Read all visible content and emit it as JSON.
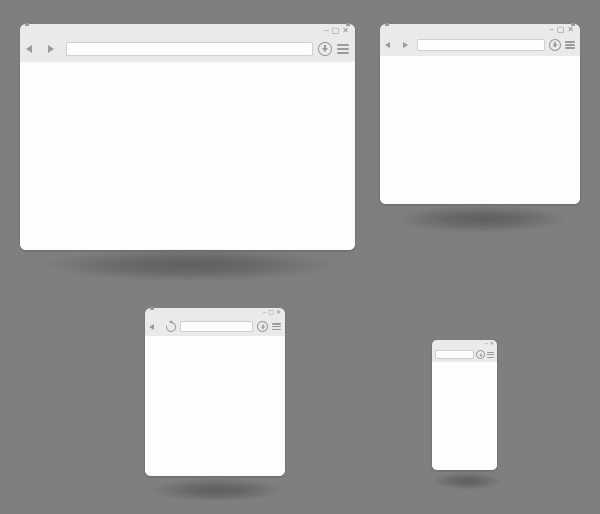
{
  "windows": [
    {
      "type": "desktop-large",
      "controls": {
        "minimize": "–",
        "maximize": "▢",
        "close": "✕"
      },
      "navigation": {
        "back": "back",
        "forward": "forward"
      },
      "url_value": "",
      "download_icon": "download",
      "menu_icon": "menu"
    },
    {
      "type": "desktop-medium",
      "controls": {
        "minimize": "–",
        "maximize": "▢",
        "close": "✕"
      },
      "navigation": {
        "back": "back",
        "forward": "forward"
      },
      "url_value": "",
      "download_icon": "download",
      "menu_icon": "menu"
    },
    {
      "type": "tablet",
      "controls": {
        "minimize": "–",
        "maximize": "▢",
        "close": "✕"
      },
      "navigation": {
        "back": "back",
        "refresh": "refresh"
      },
      "url_value": "",
      "download_icon": "download",
      "menu_icon": "menu"
    },
    {
      "type": "phone",
      "controls": {
        "minimize": "–",
        "close": "✕"
      },
      "url_value": "",
      "download_icon": "download",
      "menu_icon": "menu"
    }
  ],
  "colors": {
    "background": "#7f7f7f",
    "window_bg": "#fdfdfd",
    "chrome_bg": "#eaeaea",
    "icon": "#9a9a9a"
  }
}
